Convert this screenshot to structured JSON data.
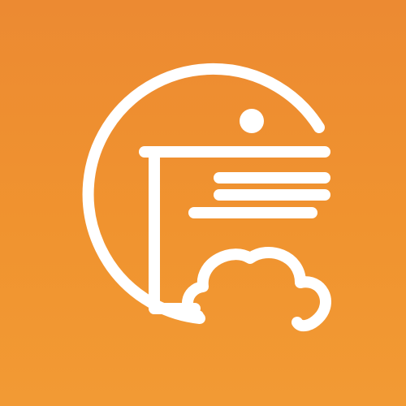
{
  "app_icon": {
    "logo_name": "logo-mark-icon",
    "background_color": "#ef8f33",
    "mark_color": "#ffffff"
  }
}
